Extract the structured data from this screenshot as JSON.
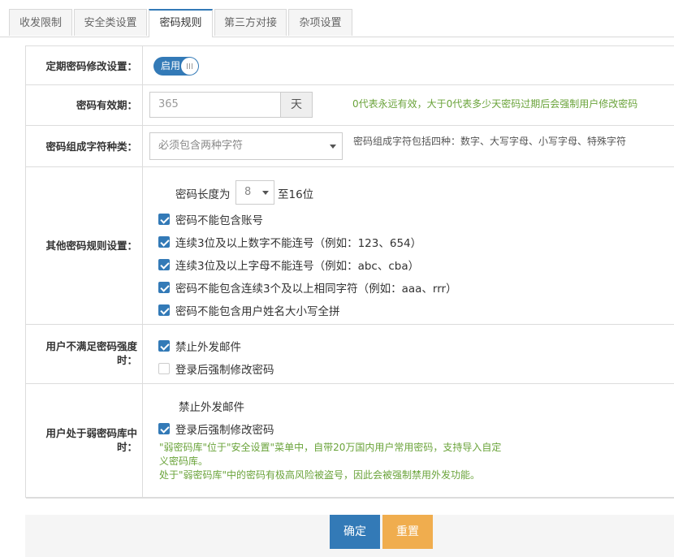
{
  "tabs": [
    {
      "label": "收发限制"
    },
    {
      "label": "安全类设置"
    },
    {
      "label": "密码规则"
    },
    {
      "label": "第三方对接"
    },
    {
      "label": "杂项设置"
    }
  ],
  "active_tab": "密码规则",
  "form": {
    "periodic": {
      "label": "定期密码修改设置：",
      "toggle_text": "启用",
      "toggle_on": true
    },
    "validity": {
      "label": "密码有效期：",
      "value": "365",
      "unit": "天",
      "hint": "0代表永远有效，大于0代表多少天密码过期后会强制用户修改密码"
    },
    "composition": {
      "label": "密码组成字符种类：",
      "selected": "必须包含两种字符",
      "hint": "密码组成字符包括四种：数字、大写字母、小写字母、特殊字符"
    },
    "other_rules": {
      "label": "其他密码规则设置：",
      "length_prefix": "密码长度为",
      "length_value": "8",
      "length_suffix": "至16位",
      "options": [
        {
          "label": "密码不能包含账号",
          "checked": true
        },
        {
          "label": "连续3位及以上数字不能连号（例如：123、654）",
          "checked": true
        },
        {
          "label": "连续3位及以上字母不能连号（例如：abc、cba）",
          "checked": true
        },
        {
          "label": "密码不能包含连续3个及以上相同字符（例如：aaa、rrr）",
          "checked": true
        },
        {
          "label": "密码不能包含用户姓名大小写全拼",
          "checked": true
        }
      ]
    },
    "weak_strength": {
      "label_line1": "用户不满足密码强度",
      "label_line2": "时：",
      "options": [
        {
          "label": "禁止外发邮件",
          "checked": true
        },
        {
          "label": "登录后强制修改密码",
          "checked": false
        }
      ]
    },
    "weak_library": {
      "label_line1": "用户处于弱密码库中",
      "label_line2": "时：",
      "static_option": "禁止外发邮件",
      "option": {
        "label": "登录后强制修改密码",
        "checked": true
      },
      "note_line1": "\"弱密码库\"位于\"安全设置\"菜单中，自带20万国内用户常用密码，支持导入自定",
      "note_line2": "义密码库。",
      "note_line3": "处于\"弱密码库\"中的密码有极高风险被盗号，因此会被强制禁用外发功能。"
    }
  },
  "buttons": {
    "confirm": "确定",
    "reset": "重置"
  },
  "colors": {
    "primary": "#337ab7",
    "warning": "#f0ad4e",
    "hint_green": "#6aa33a"
  }
}
